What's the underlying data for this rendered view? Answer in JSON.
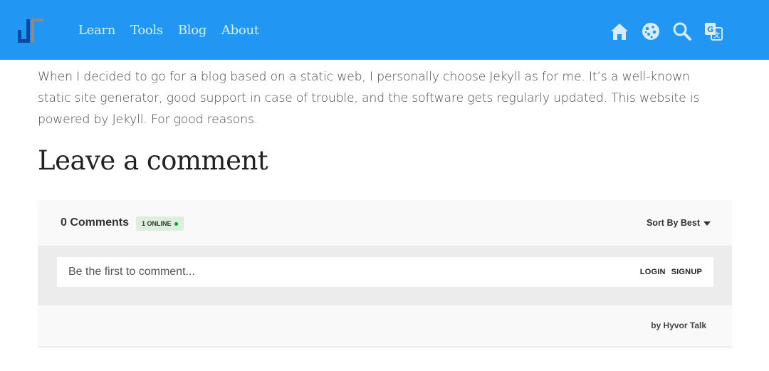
{
  "header": {
    "nav": [
      "Learn",
      "Tools",
      "Blog",
      "About"
    ],
    "icons": [
      "home-icon",
      "cookie-icon",
      "search-icon",
      "translate-icon"
    ],
    "colors": {
      "background": "#2196f3",
      "nav_text": "#dbeeff"
    }
  },
  "content": {
    "intro": "When I decided to go for a blog based on a static web, I personally choose Jekyll as for me. It’s a well-known static site generator, good support in case of trouble, and the software gets regularly updated. This website is powered by Jekyll. For good reasons.",
    "heading": "Leave a comment"
  },
  "comments": {
    "count_label": "0 Comments",
    "online_label": "1 ONLINE",
    "sort_label": "Sort By Best",
    "input_placeholder": "Be the first to comment...",
    "login_label": "LOGIN",
    "signup_label": "SIGNUP",
    "powered_by": "by Hyvor Talk",
    "colors": {
      "online_dot": "#0b9e2c",
      "online_badge": "#dcefdc"
    }
  }
}
